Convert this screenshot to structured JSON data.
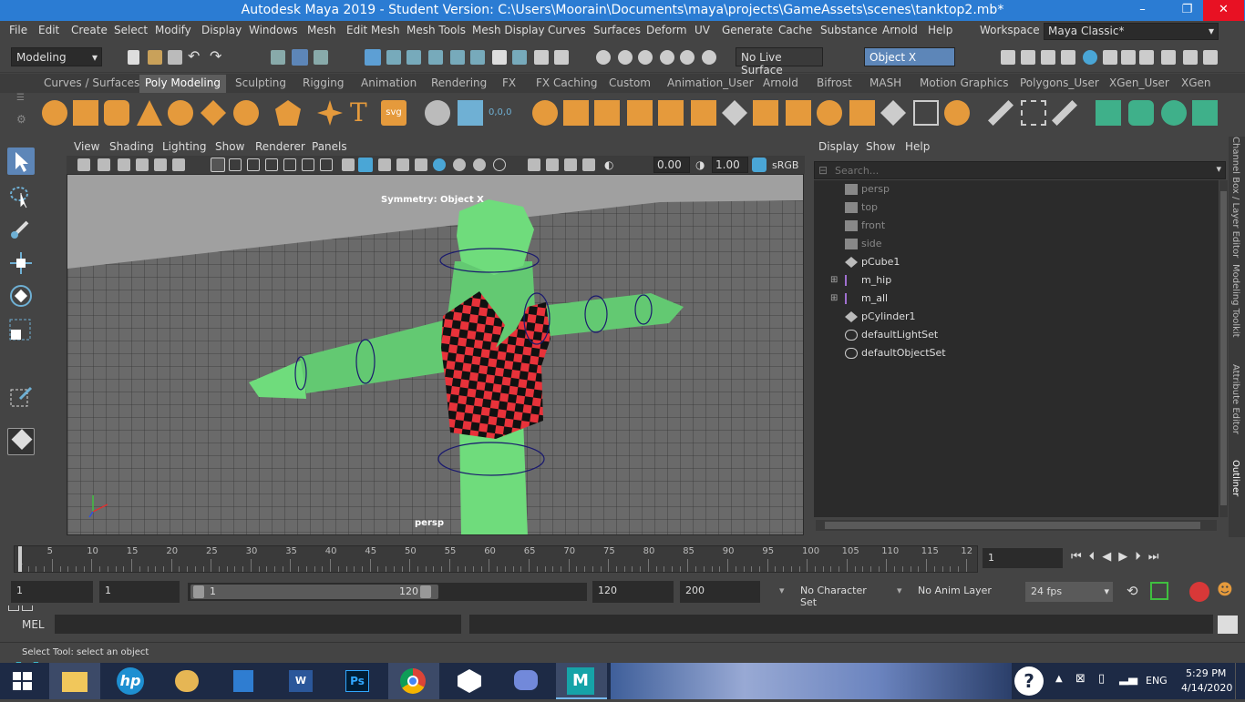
{
  "title_bar": {
    "title": "Autodesk Maya 2019 - Student Version: C:\\Users\\Moorain\\Documents\\maya\\projects\\GameAssets\\scenes\\tanktop2.mb*",
    "minimize": "–",
    "maximize": "❐",
    "close": "✕"
  },
  "menubar": {
    "items": [
      "File",
      "Edit",
      "Create",
      "Select",
      "Modify",
      "Display",
      "Windows",
      "Mesh",
      "Edit Mesh",
      "Mesh Tools",
      "Mesh Display",
      "Curves",
      "Surfaces",
      "Deform",
      "UV",
      "Generate",
      "Cache",
      "Substance",
      "Arnold",
      "Help"
    ],
    "workspace_label": "Workspace :",
    "workspace_value": "Maya Classic*"
  },
  "statusline": {
    "menu_set": "Modeling",
    "live_surface": "No Live Surface",
    "symmetry": "Object X"
  },
  "shelf_tabs": [
    "Curves / Surfaces",
    "Poly Modeling",
    "Sculpting",
    "Rigging",
    "Animation",
    "Rendering",
    "FX",
    "FX Caching",
    "Custom",
    "Animation_User",
    "Arnold",
    "Bifrost",
    "MASH",
    "Motion Graphics",
    "Polygons_User",
    "XGen_User",
    "XGen"
  ],
  "shelf_active": "Poly Modeling",
  "panel_menu": [
    "View",
    "Shading",
    "Lighting",
    "Show",
    "Renderer",
    "Panels"
  ],
  "panel_toolbar": {
    "exposure": "0.00",
    "gamma": "1.00",
    "colorspace": "sRGB g"
  },
  "viewport": {
    "symmetry_label": "Symmetry: Object X",
    "camera_label": "persp"
  },
  "outliner": {
    "menu": [
      "Display",
      "Show",
      "Help"
    ],
    "search_placeholder": "Search...",
    "items": [
      {
        "name": "persp",
        "dim": true,
        "expand": false
      },
      {
        "name": "top",
        "dim": true,
        "expand": false
      },
      {
        "name": "front",
        "dim": true,
        "expand": false
      },
      {
        "name": "side",
        "dim": true,
        "expand": false
      },
      {
        "name": "pCube1",
        "dim": false,
        "expand": false
      },
      {
        "name": "m_hip",
        "dim": false,
        "expand": true
      },
      {
        "name": "m_all",
        "dim": false,
        "expand": true
      },
      {
        "name": "pCylinder1",
        "dim": false,
        "expand": false
      },
      {
        "name": "defaultLightSet",
        "dim": false,
        "expand": false
      },
      {
        "name": "defaultObjectSet",
        "dim": false,
        "expand": false
      }
    ]
  },
  "side_tabs": [
    "Channel Box / Layer Editor",
    "Modeling Toolkit",
    "Attribute Editor",
    "Outliner"
  ],
  "timeline": {
    "ticks": [
      "1",
      "5",
      "10",
      "15",
      "20",
      "25",
      "30",
      "35",
      "40",
      "45",
      "50",
      "55",
      "60",
      "65",
      "70",
      "75",
      "80",
      "85",
      "90",
      "95",
      "100",
      "105",
      "110",
      "115",
      "12"
    ],
    "current_frame": "1"
  },
  "range": {
    "start": "1",
    "playback_start": "1",
    "slider_start": "1",
    "slider_end": "120",
    "playback_end": "120",
    "end": "200",
    "character_set": "No Character Set",
    "anim_layer": "No Anim Layer",
    "fps": "24 fps"
  },
  "cmdline": {
    "label": "MEL"
  },
  "helpline": {
    "text": "Select Tool: select an object"
  },
  "taskbar": {
    "lang": "ENG",
    "time": "5:29 PM",
    "date": "4/14/2020"
  },
  "colors": {
    "accent": "#2b7cd3",
    "panel": "#444444",
    "viewport": "#9c9c9c",
    "model_green": "#6fdc7c",
    "checker_red": "#e8323a"
  }
}
